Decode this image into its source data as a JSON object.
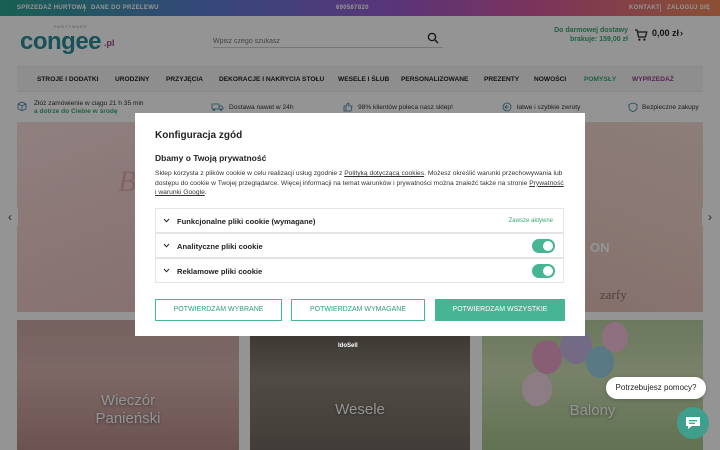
{
  "topbar": {
    "wholesale": "SPRZEDAŻ HURTOWA",
    "refund": "DANE DO PRZELEWU",
    "phone": "690587820",
    "contact": "KONTAKT",
    "login": "ZALOGUJ SIĘ"
  },
  "header": {
    "logo": "congee",
    "logo_tld": ".pl",
    "logo_tag": "PARTYWARE",
    "search_placeholder": "Wpisz czego szukasz",
    "free_shipping_line1": "Do darmowej dostawy",
    "free_shipping_line2": "brakuje: 159,00 zł",
    "cart_total": "0,00 zł"
  },
  "nav": {
    "items": [
      "STROJE I DODATKI",
      "URODZINY",
      "PRZYJĘCIA",
      "DEKORACJE I NAKRYCIA STOŁU",
      "WESELE I ŚLUB",
      "PERSONALIZOWANE",
      "PREZENTY",
      "NOWOŚCI",
      "POMYSŁY",
      "WYPRZEDAŻ"
    ],
    "colors": {
      "pomysly": "#3aa874",
      "wyprzedaz": "#9b3f8e"
    }
  },
  "info_bar": {
    "order_line1": "Złóż zamówienie w ciągu 21 h 35 min",
    "order_line2": "a dotrze do Ciebie w środę",
    "delivery": "Dostawa nawet w 24h",
    "recommend": "98% klientów poleca nasz sklep!",
    "returns": "łatwe i szybkie zwroty",
    "secure": "Bezpieczne zakupy"
  },
  "hero": {
    "left_text": "B",
    "right_on": "ON",
    "right_text": "zarfy"
  },
  "tiles": [
    {
      "label": "Wieczór Panieński"
    },
    {
      "label": "Wesele"
    },
    {
      "label": "Balony"
    }
  ],
  "tile1_line1": "Wieczór",
  "tile1_line2": "Panieński",
  "idosell": "IdoSell",
  "modal": {
    "title": "Konfiguracja zgód",
    "subtitle": "Dbamy o Twoją prywatność",
    "text_1": "Sklep korzysta z plików cookie w celu realizacji usług zgodnie z ",
    "link_policy": "Polityką dotyczącą cookies",
    "text_2": ". Możesz określić warunki przechowywania lub dostępu do cookie w Twojej przeglądarce. Więcej informacji na temat warunków i prywatności można znaleźć także na stronie ",
    "link_terms": "Prywatność i warunki Google",
    "text_3": ".",
    "sections": [
      {
        "label": "Funkcjonalne pliki cookie (wymagane)",
        "note": "Zawsze aktywne"
      },
      {
        "label": "Analityczne pliki cookie",
        "enabled": true
      },
      {
        "label": "Reklamowe pliki cookie",
        "enabled": true
      }
    ],
    "btn_selected": "POTWIERDZAM WYBRANE",
    "btn_required": "POTWIERDZAM WYMAGANE",
    "btn_all": "POTWIERDZAM WSZYSTKIE",
    "accent": "#45b594"
  },
  "chat": {
    "bubble": "Potrzebujesz pomocy?"
  },
  "arrows": {
    "left": "‹",
    "right": "›"
  }
}
